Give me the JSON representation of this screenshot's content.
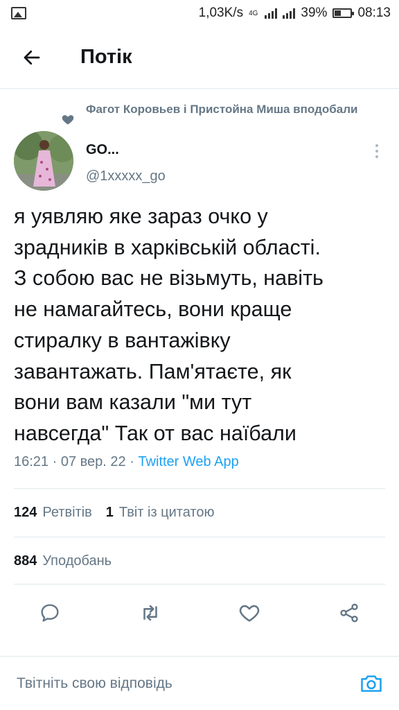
{
  "status_bar": {
    "speed": "1,03K/s",
    "network_tag": "4G",
    "battery": "39%",
    "time": "08:13"
  },
  "header": {
    "title": "Потік"
  },
  "tweet": {
    "social_context": "Фагот Коровьев і Пристойна Миша вподобали",
    "author_name": "GO...",
    "author_handle": "@1xxxxx_go",
    "text": "я уявляю яке зараз очко у\nзрадників в харківській області.\nЗ собою вас не візьмуть, навіть\nне намагайтесь, вони краще\nстиралку в вантажівку\nзавантажать. Пам'ятаєте, як\nвони вам казали \"ми тут\nнавсегда\" Так от вас наїбали",
    "time": "16:21",
    "date": "07 вер. 22",
    "sep": " · ",
    "source": "Twitter Web App",
    "retweets_count": "124",
    "retweets_label": "Ретвітів",
    "quotes_count": "1",
    "quotes_label": "Твіт із цитатою",
    "likes_count": "884",
    "likes_label": "Уподобань"
  },
  "reply": {
    "placeholder": "Твітніть свою відповідь"
  },
  "colors": {
    "accent": "#1da1f2",
    "secondary_text": "#657786",
    "icon_gray": "#657786",
    "divider": "#e1e8ed"
  },
  "icons": {
    "back": "arrow-left-icon",
    "liked_by": "heart-icon",
    "more": "more-vertical-icon",
    "reply": "comment-icon",
    "retweet": "retweet-icon",
    "like": "heart-icon",
    "share": "share-icon",
    "camera": "camera-icon"
  }
}
